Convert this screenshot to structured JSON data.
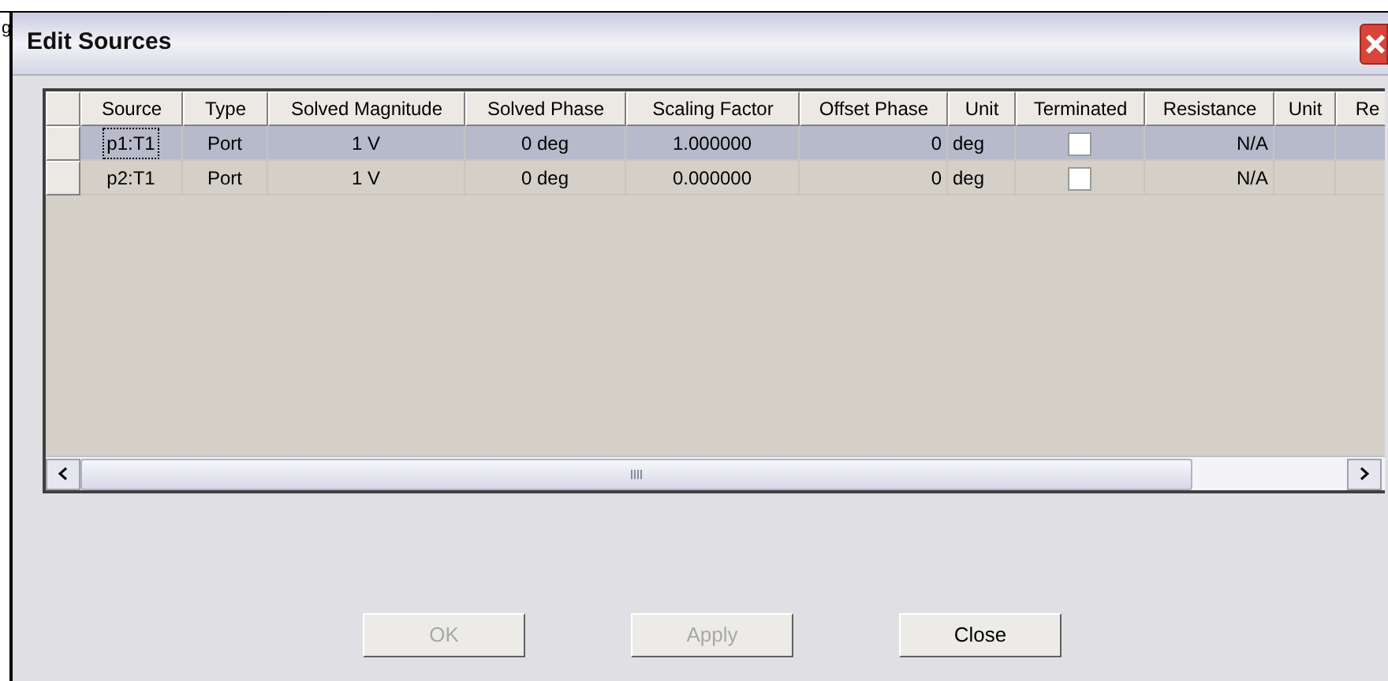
{
  "background_window": {
    "text": "g"
  },
  "window": {
    "title": "Edit Sources"
  },
  "table": {
    "columns": [
      "Source",
      "Type",
      "Solved Magnitude",
      "Solved Phase",
      "Scaling Factor",
      "Offset Phase",
      "Unit",
      "Terminated",
      "Resistance",
      "Unit",
      "Re"
    ],
    "rows": [
      {
        "selected": true,
        "source": "p1:T1",
        "type": "Port",
        "solved_magnitude": "1 V",
        "solved_phase": "0 deg",
        "scaling_factor": "1.000000",
        "offset_phase": "0",
        "unit": "deg",
        "terminated": false,
        "resistance": "N/A"
      },
      {
        "selected": false,
        "source": "p2:T1",
        "type": "Port",
        "solved_magnitude": "1 V",
        "solved_phase": "0 deg",
        "scaling_factor": "0.000000",
        "offset_phase": "0",
        "unit": "deg",
        "terminated": false,
        "resistance": "N/A"
      }
    ]
  },
  "buttons": [
    {
      "label": "OK",
      "disabled": true
    },
    {
      "label": "Apply",
      "disabled": true
    },
    {
      "label": "Close",
      "disabled": false
    }
  ]
}
